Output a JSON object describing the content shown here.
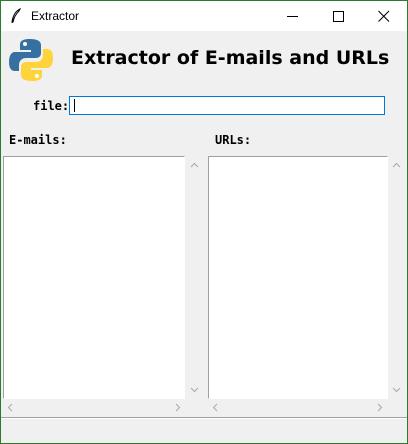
{
  "window": {
    "title": "Extractor",
    "icon": "feather-icon",
    "controls": [
      "minimize-icon",
      "maximize-icon",
      "close-icon"
    ]
  },
  "header": {
    "logo": "python-logo",
    "headline": "Extractor of E-mails and URLs"
  },
  "file": {
    "label": "file:",
    "value": ""
  },
  "emails": {
    "label": "E-mails:",
    "items": []
  },
  "urls": {
    "label": "URLs:",
    "items": []
  },
  "status": {
    "text": ""
  },
  "colors": {
    "window_border": "#2c7a2c",
    "input_focus_border": "#0078d7",
    "background": "#f0f0f0",
    "python_blue": "#3670a0",
    "python_yellow": "#ffd43b"
  }
}
